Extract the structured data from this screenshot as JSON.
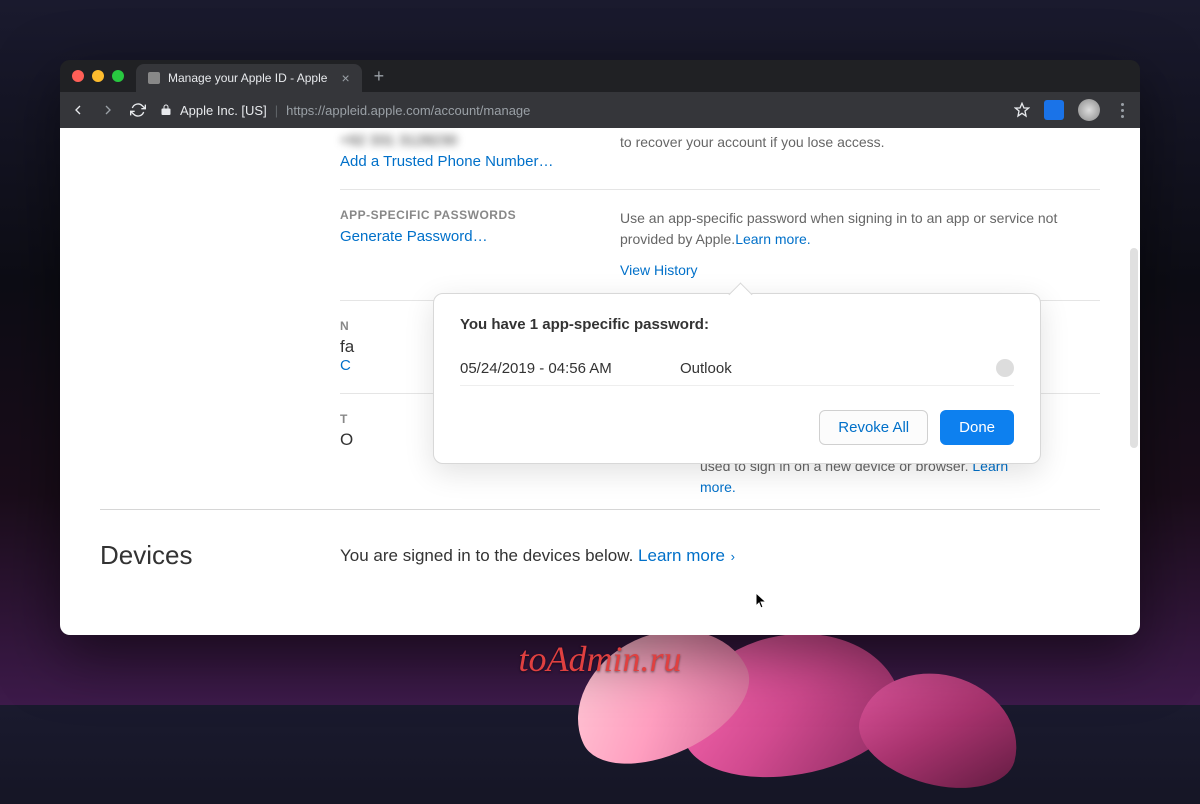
{
  "browser": {
    "tab_title": "Manage your Apple ID - Apple",
    "new_tab": "+",
    "close_tab": "×",
    "address_org": "Apple Inc. [US]",
    "address_url": "https://appleid.apple.com/account/manage"
  },
  "trusted_phone": {
    "masked_number": "+92 331 3128230",
    "add_link": "Add a Trusted Phone Number…",
    "desc": "to recover your account if you lose access."
  },
  "app_passwords": {
    "label": "APP-SPECIFIC PASSWORDS",
    "generate": "Generate Password…",
    "desc_pre": "Use an app-specific password when signing in to an app or service not provided by Apple.",
    "learn_more": "Learn more.",
    "view_history": "View History"
  },
  "notify": {
    "label_char": "N",
    "value_char": "fa",
    "link_char": "C"
  },
  "tfa": {
    "label_char": "T",
    "value_char": "O",
    "desc_tail": "used to sign in on a new device or browser. ",
    "learn_more": "Learn more."
  },
  "popover": {
    "title": "You have 1 app-specific password:",
    "items": [
      {
        "date": "05/24/2019 - 04:56 AM",
        "name": "Outlook"
      }
    ],
    "revoke_all": "Revoke All",
    "done": "Done"
  },
  "devices": {
    "title": "Devices",
    "desc": "You are signed in to the devices below. ",
    "learn_more": "Learn more"
  },
  "watermark": "toAdmin.ru"
}
